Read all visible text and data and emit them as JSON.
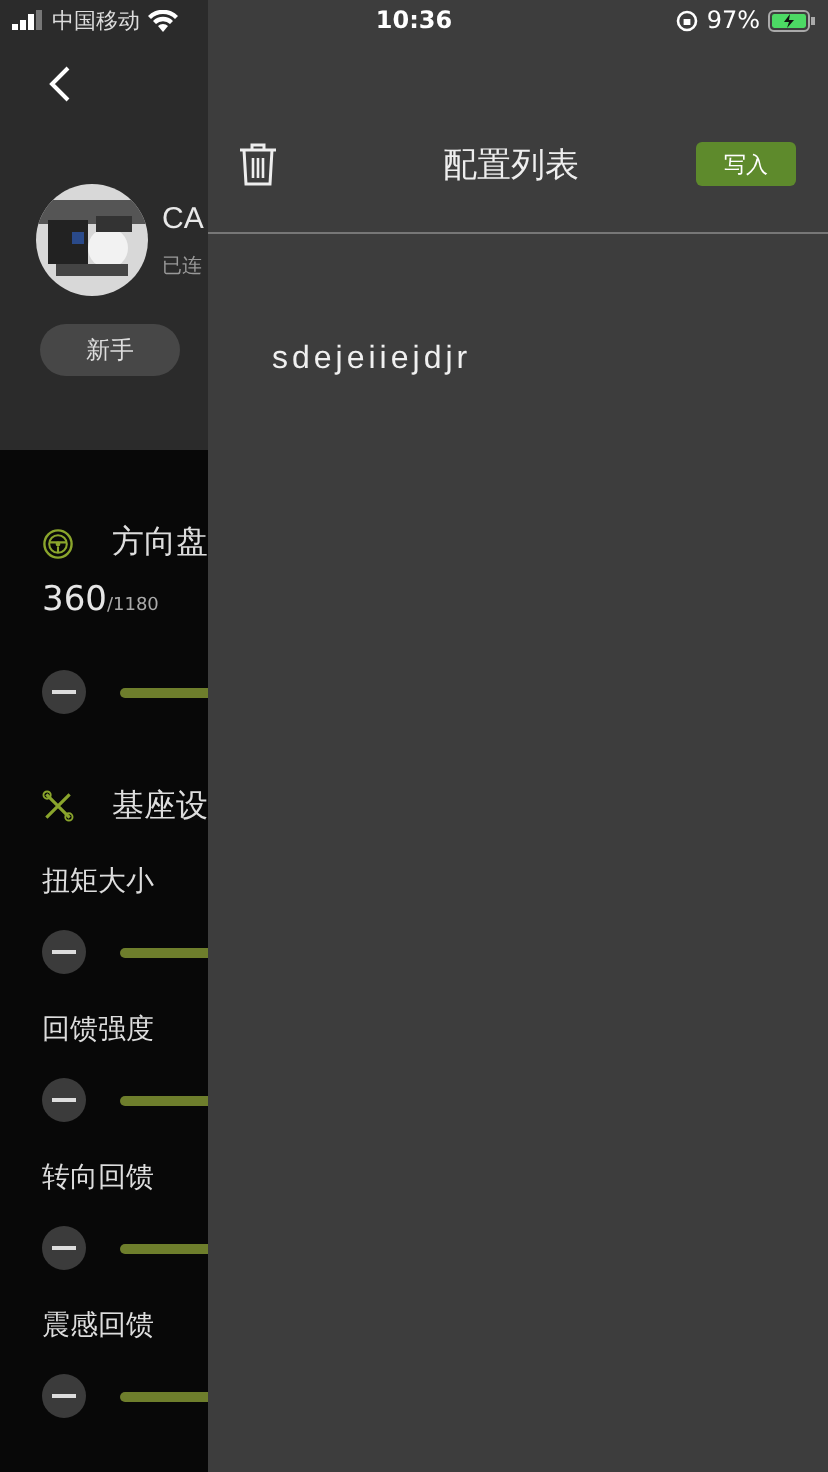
{
  "status_bar": {
    "carrier": "中国移动",
    "time": "10:36",
    "battery": "97%"
  },
  "page": {
    "device": {
      "name": "CA",
      "status": "已连"
    },
    "mode_button": "新手",
    "rotation": {
      "title": "方向盘",
      "value": "360",
      "max": "/1180"
    },
    "base": {
      "title": "基座设",
      "params": [
        {
          "label": "扭矩大小"
        },
        {
          "label": "回馈强度"
        },
        {
          "label": "转向回馈"
        },
        {
          "label": "震感回馈"
        }
      ]
    }
  },
  "drawer": {
    "title": "配置列表",
    "write_button": "写入",
    "configs": [
      {
        "name": "sdejeiiejdjr"
      }
    ]
  }
}
